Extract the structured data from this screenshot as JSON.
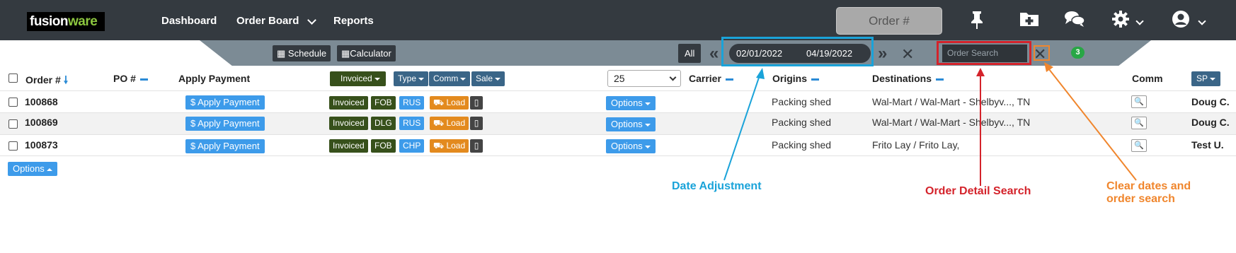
{
  "navbar": {
    "logo_left": "fusion",
    "logo_right": "ware",
    "links": [
      "Dashboard",
      "Order Board",
      "Reports"
    ],
    "order_button": "Order #",
    "icons": [
      "pin-icon",
      "folder-plus-icon",
      "chat-icon",
      "gear-icon",
      "user-icon"
    ]
  },
  "toolbar": {
    "schedule": "Schedule",
    "calculator": "Calculator",
    "all": "All",
    "date_from": "02/01/2022",
    "date_to": "04/19/2022",
    "search_placeholder": "Order Search",
    "badge_count": "3"
  },
  "table": {
    "headers": {
      "order": "Order #",
      "po": "PO #",
      "apply_payment": "Apply Payment",
      "invoiced": "Invoiced",
      "type": "Type",
      "comm": "Comm",
      "sale": "Sale",
      "per_page": "25",
      "carrier": "Carrier",
      "origins": "Origins",
      "destinations": "Destinations",
      "comm_col": "Comm",
      "sp": "SP"
    },
    "rows": [
      {
        "order": "100868",
        "apply": "$ Apply Payment",
        "status": "Invoiced",
        "type": "FOB",
        "comm": "RUS",
        "load": "Load",
        "options": "Options",
        "origin": "Packing shed",
        "destination": "Wal-Mart / Wal-Mart - Shelbyv..., TN",
        "sp": "Doug C."
      },
      {
        "order": "100869",
        "apply": "$ Apply Payment",
        "status": "Invoiced",
        "type": "DLG",
        "comm": "RUS",
        "load": "Load",
        "options": "Options",
        "origin": "Packing shed",
        "destination": "Wal-Mart / Wal-Mart - Shelbyv..., TN",
        "sp": "Doug C."
      },
      {
        "order": "100873",
        "apply": "$ Apply Payment",
        "status": "Invoiced",
        "type": "FOB",
        "comm": "CHP",
        "load": "Load",
        "options": "Options",
        "origin": "Packing shed",
        "destination": "Frito Lay / Frito Lay,",
        "sp": "Test U."
      }
    ],
    "footer_options": "Options"
  },
  "annotations": {
    "date": {
      "text": "Date Adjustment",
      "color": "#1aa3d9"
    },
    "search": {
      "text": "Order Detail Search",
      "color": "#d4232b"
    },
    "clear_line1": "Clear dates and",
    "clear_line2": "order search",
    "clear_color": "#f0862d"
  }
}
